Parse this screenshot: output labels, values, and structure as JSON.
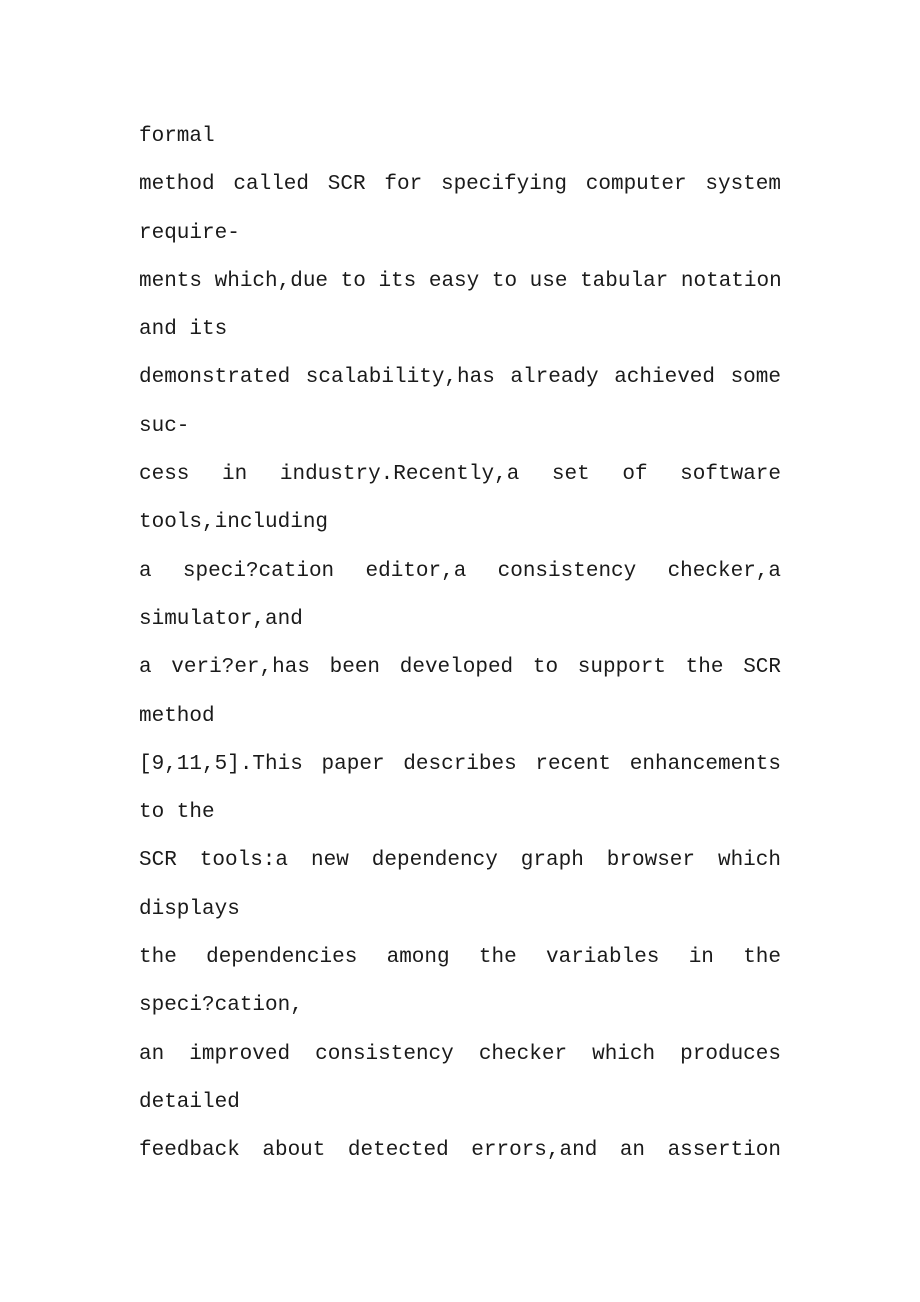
{
  "document": {
    "lines": [
      {
        "text": "formal",
        "justify": false
      },
      {
        "text": "method called SCR for specifying computer system",
        "justify": true
      },
      {
        "text": "require-",
        "justify": false
      },
      {
        "text": "ments which,due to its easy to use tabular notation",
        "justify": true
      },
      {
        "text": "and its",
        "justify": false
      },
      {
        "text": "demonstrated scalability,has already achieved some",
        "justify": true
      },
      {
        "text": "suc-",
        "justify": false
      },
      {
        "text": "cess in industry.Recently,a set of software",
        "justify": true
      },
      {
        "text": "tools,including",
        "justify": false
      },
      {
        "text": "a speci?cation editor,a consistency checker,a",
        "justify": true
      },
      {
        "text": "simulator,and",
        "justify": false
      },
      {
        "text": "a veri?er,has been developed to support the SCR",
        "justify": true
      },
      {
        "text": "method",
        "justify": false
      },
      {
        "text": "[9,11,5].This paper describes recent enhancements",
        "justify": true
      },
      {
        "text": "to the",
        "justify": false
      },
      {
        "text": "SCR tools:a new dependency graph browser which",
        "justify": true
      },
      {
        "text": "displays",
        "justify": false
      },
      {
        "text": "the dependencies among the variables in the",
        "justify": true
      },
      {
        "text": "speci?cation,",
        "justify": false
      },
      {
        "text": "an improved consistency checker which produces",
        "justify": true
      },
      {
        "text": "detailed",
        "justify": false
      },
      {
        "text": "feedback about detected errors,and an assertion",
        "justify": true
      }
    ]
  }
}
